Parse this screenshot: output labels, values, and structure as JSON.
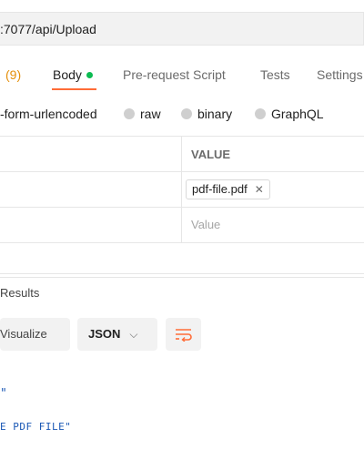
{
  "request": {
    "url": ":7077/api/Upload"
  },
  "tabs": {
    "headers_count": "(9)",
    "body": "Body",
    "prerequest": "Pre-request Script",
    "tests": "Tests",
    "settings": "Settings"
  },
  "body_options": {
    "urlencoded": "-form-urlencoded",
    "raw": "raw",
    "binary": "binary",
    "graphql": "GraphQL"
  },
  "form_table": {
    "value_header": "VALUE",
    "file_name": "pdf-file.pdf",
    "file_remove": "✕",
    "value_placeholder": "Value"
  },
  "response": {
    "results_label": "Results",
    "visualize_label": "Visualize",
    "format_label": "JSON",
    "format_chevron": "⌵",
    "code_brace": "\"",
    "code_string": "E PDF FILE\""
  },
  "colors": {
    "accent": "#ff6c37",
    "body_dot": "#0cbb52",
    "count": "#e58f0a",
    "code": "#1b58b5"
  }
}
